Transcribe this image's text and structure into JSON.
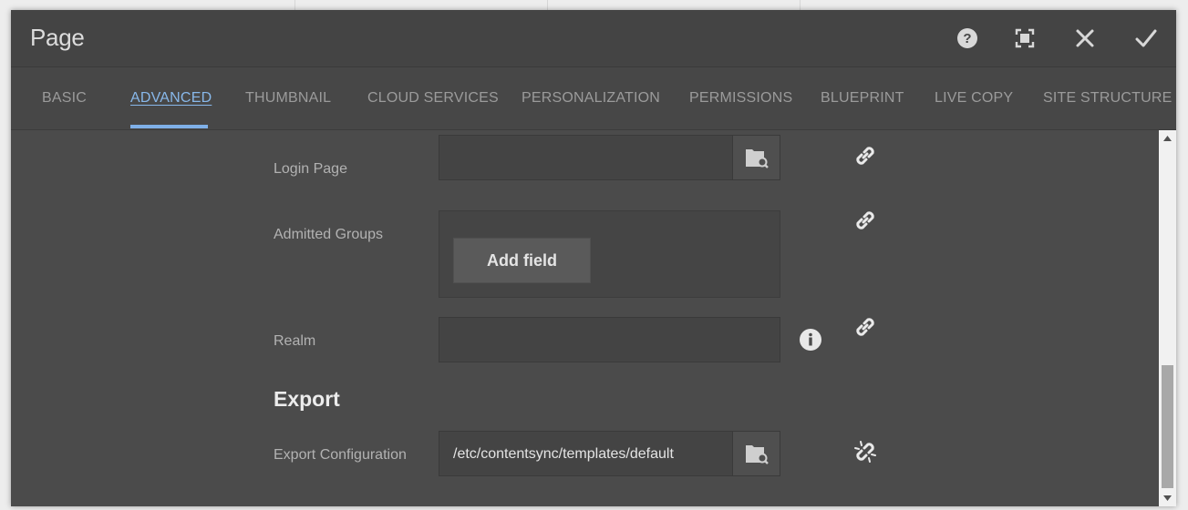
{
  "dialog": {
    "title": "Page"
  },
  "header_buttons": {
    "help": "help-icon",
    "fullscreen": "fullscreen-icon",
    "close": "close-icon",
    "done": "checkmark-icon"
  },
  "tabs": [
    {
      "label": "BASIC",
      "active": false
    },
    {
      "label": "ADVANCED",
      "active": true
    },
    {
      "label": "THUMBNAIL",
      "active": false
    },
    {
      "label": "CLOUD SERVICES",
      "active": false
    },
    {
      "label": "PERSONALIZATION",
      "active": false
    },
    {
      "label": "PERMISSIONS",
      "active": false
    },
    {
      "label": "BLUEPRINT",
      "active": false
    },
    {
      "label": "LIVE COPY",
      "active": false
    },
    {
      "label": "SITE STRUCTURE",
      "active": false
    }
  ],
  "form": {
    "login_page": {
      "label": "Login Page",
      "value": ""
    },
    "admitted_groups": {
      "label": "Admitted Groups",
      "add_label": "Add field"
    },
    "realm": {
      "label": "Realm",
      "value": ""
    },
    "export_section": "Export",
    "export_configuration": {
      "label": "Export Configuration",
      "value": "/etc/contentsync/templates/default"
    }
  },
  "colors": {
    "accent": "#7fb0e8",
    "dialog_bg": "#4b4b4b",
    "header_bg": "#444444"
  }
}
